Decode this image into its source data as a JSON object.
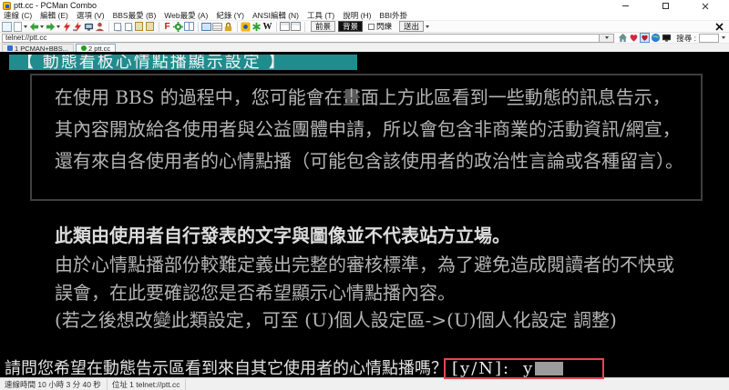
{
  "window": {
    "title": "ptt.cc - PCMan Combo"
  },
  "menu_items": [
    "連線 (C)",
    "編輯 (E)",
    "選項 (V)",
    "BBS最愛 (B)",
    "Web最愛 (A)",
    "紀錄 (Y)",
    "ANSI編輯 (N)",
    "工具 (T)",
    "說明 (H)",
    "BBI外掛"
  ],
  "toolbar": {
    "icons": [
      "site-list",
      "new-connection",
      "back",
      "forward",
      "connect",
      "disconnect",
      "duplicate-window",
      "user-info",
      "copy",
      "copy-ansi",
      "paste",
      "paste-quote",
      "ansi-color",
      "settings",
      "split-window",
      "image-preview",
      "display-options",
      "lock",
      "pcman-home",
      "plugin",
      "wikipedia",
      "board-list",
      "favorite-board"
    ],
    "glyph_ansi": "F",
    "glyph_wikipedia": "W",
    "foreground_label": "前景",
    "background_label": "背景",
    "blink_label": "閃爍",
    "send_label": "送出"
  },
  "address": {
    "value": "telnet://ptt.cc",
    "search_label": "搜尋 :"
  },
  "tabs": [
    {
      "label": "1 PCMAN+BBS..."
    },
    {
      "label": "2 ptt.cc"
    }
  ],
  "terminal": {
    "header": "【 動態看板心情點播顯示設定 】",
    "box_lines": [
      "在使用 BBS 的過程中，您可能會在畫面上方此區看到一些動態的訊息告示，",
      "其內容開放給各使用者與公益團體申請，所以會包含非商業的活動資訊/網宣，",
      "還有來自各使用者的心情點播（可能包含該使用者的政治性言論或各種留言）。"
    ],
    "statement": "此類由使用者自行發表的文字與圖像並不代表站方立場。",
    "body_lines": [
      "由於心情點播部份較難定義出完整的審核標準，為了避免造成閱讀者的不快或",
      "誤會，在此要確認您是否希望顯示心情點播內容。",
      "(若之後想改變此類設定，可至 (U)個人設定區->(U)個人化設定 調整)"
    ],
    "prompt": "請問您希望在動態告示區看到來自其它使用者的心情點播嗎？",
    "answer_label": "[y/N]:",
    "answer_value": "y"
  },
  "statusbar": {
    "connection_time": "連線時間 10 小時 3 分 40 秒",
    "location": "位址 1 telnet://ptt.cc"
  },
  "colors": {
    "header_bg": "#1f8d8d",
    "annotation_red": "#e6454b",
    "terminal_bg": "#000000"
  }
}
